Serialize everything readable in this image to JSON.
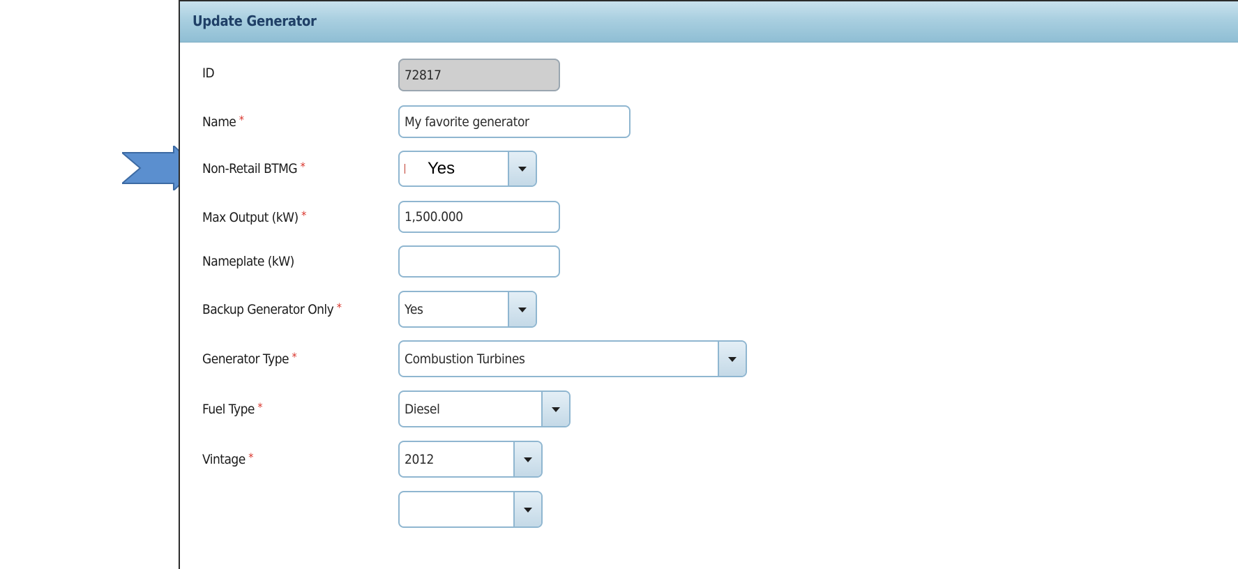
{
  "panel": {
    "title": "Update Generator"
  },
  "form": {
    "id": {
      "label": "ID",
      "value": "72817"
    },
    "name": {
      "label": "Name",
      "required": "*",
      "value": "My favorite generator"
    },
    "non_retail_btmg": {
      "label": "Non-Retail BTMG",
      "required": "*",
      "value": "Yes"
    },
    "max_output": {
      "label": "Max Output (kW)",
      "required": "*",
      "value": "1,500.000"
    },
    "nameplate": {
      "label": "Nameplate (kW)",
      "value": ""
    },
    "backup_only": {
      "label": "Backup Generator Only",
      "required": "*",
      "value": "Yes"
    },
    "generator_type": {
      "label": "Generator Type",
      "required": "*",
      "value": "Combustion Turbines"
    },
    "fuel_type": {
      "label": "Fuel Type",
      "required": "*",
      "value": "Diesel"
    },
    "vintage": {
      "label": "Vintage",
      "required": "*",
      "value": "2012"
    }
  },
  "colors": {
    "header": "#a9cfe0",
    "title": "#1f3f66",
    "required": "#d9342b",
    "field_border": "#8fb6d0",
    "readonly_bg": "#cfcfcf",
    "arrow_fill": "#5b8fcf",
    "arrow_stroke": "#3c6aa3"
  },
  "icons": {
    "annotation": "right-arrow-icon",
    "dropdown": "chevron-down-icon"
  }
}
